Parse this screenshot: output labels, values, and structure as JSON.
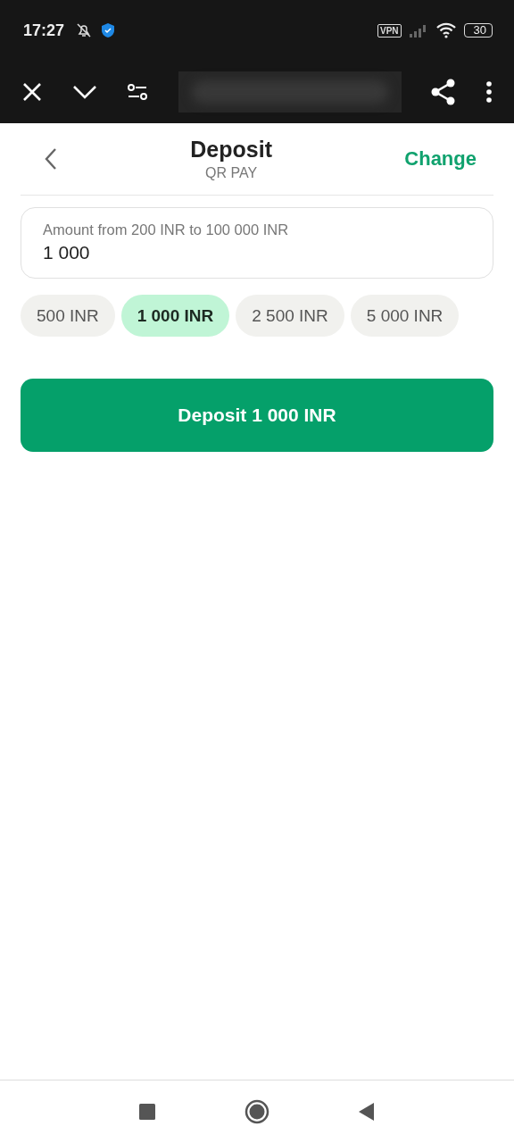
{
  "status_bar": {
    "time": "17:27",
    "vpn": "VPN",
    "battery": "30"
  },
  "header": {
    "title": "Deposit",
    "subtitle": "QR PAY",
    "action": "Change"
  },
  "amount_field": {
    "label": "Amount from 200 INR to 100 000 INR",
    "value": "1 000"
  },
  "presets": [
    {
      "label": "500 INR",
      "selected": false
    },
    {
      "label": "1 000 INR",
      "selected": true
    },
    {
      "label": "2 500 INR",
      "selected": false
    },
    {
      "label": "5 000 INR",
      "selected": false
    }
  ],
  "submit_button": "Deposit 1 000 INR"
}
